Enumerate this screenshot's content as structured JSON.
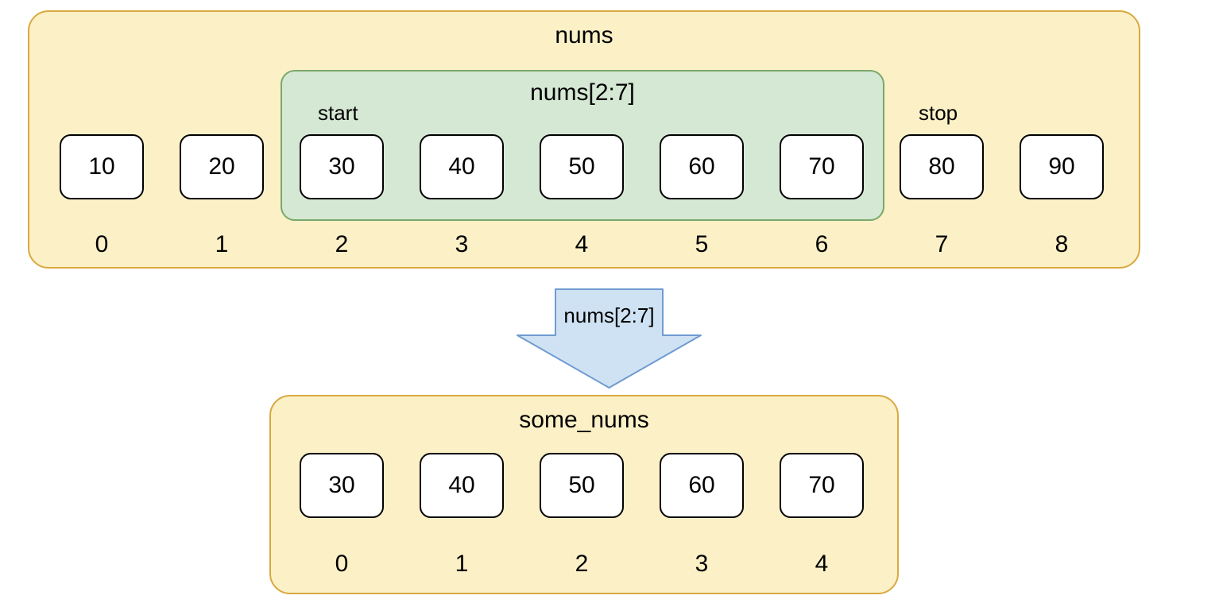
{
  "top": {
    "title": "nums",
    "slice_label": "nums[2:7]",
    "start_label": "start",
    "stop_label": "stop",
    "values": [
      "10",
      "20",
      "30",
      "40",
      "50",
      "60",
      "70",
      "80",
      "90"
    ],
    "indices": [
      "0",
      "1",
      "2",
      "3",
      "4",
      "5",
      "6",
      "7",
      "8"
    ]
  },
  "arrow": {
    "label": "nums[2:7]"
  },
  "bottom": {
    "title": "some_nums",
    "values": [
      "30",
      "40",
      "50",
      "60",
      "70"
    ],
    "indices": [
      "0",
      "1",
      "2",
      "3",
      "4"
    ]
  },
  "layout": {
    "top_cells_x": [
      75,
      226,
      377,
      528,
      679,
      830,
      981,
      1132,
      1283
    ],
    "bottom_cells_x": [
      377,
      528,
      679,
      830,
      981
    ]
  },
  "colors": {
    "yellow_fill": "#fcf0c6",
    "yellow_border": "#d9a93f",
    "green_fill": "#d5e8d4",
    "green_border": "#7aa86b",
    "arrow_fill": "#cfe2f3",
    "arrow_border": "#6f9bd1"
  }
}
